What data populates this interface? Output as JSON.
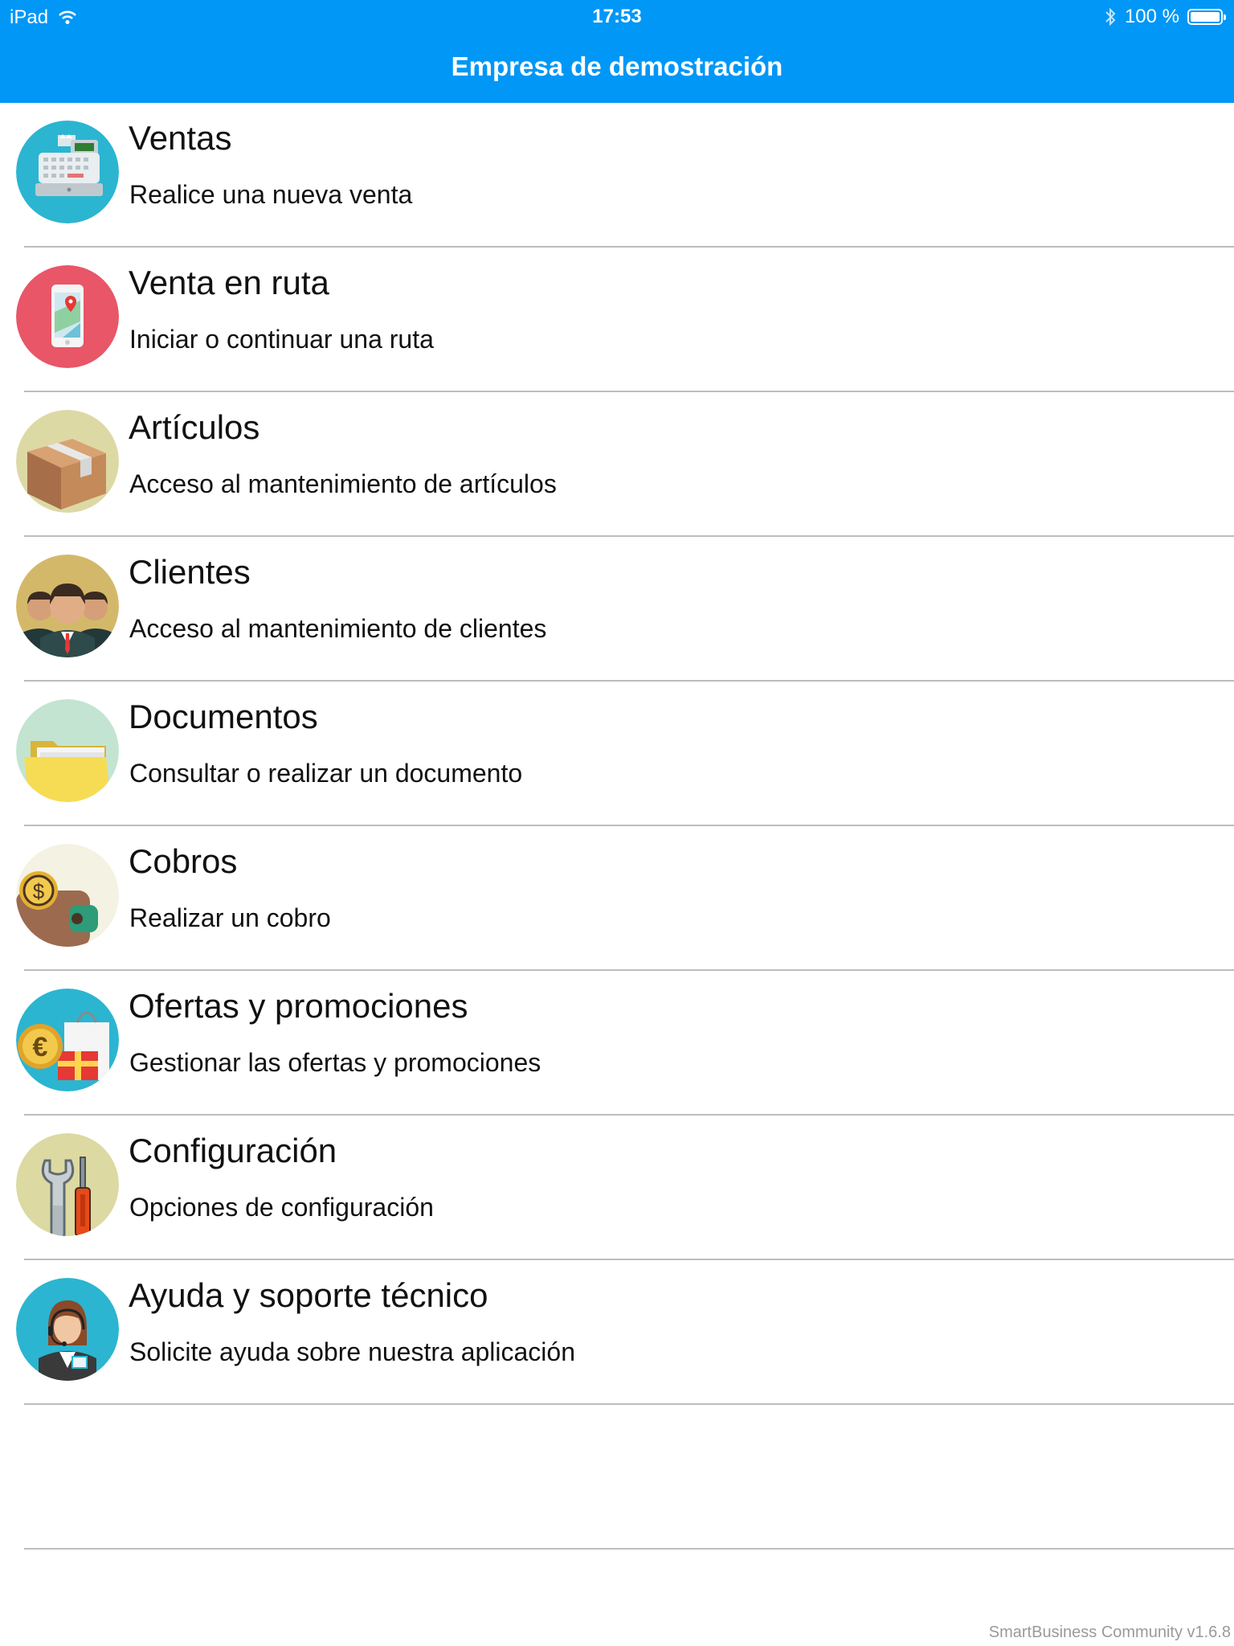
{
  "status_bar": {
    "device": "iPad",
    "time": "17:53",
    "battery": "100 %"
  },
  "header": {
    "title": "Empresa de demostración"
  },
  "menu": [
    {
      "title": "Ventas",
      "subtitle": "Realice una nueva venta",
      "icon": "cash-register-icon"
    },
    {
      "title": "Venta en ruta",
      "subtitle": "Iniciar o continuar una ruta",
      "icon": "phone-map-icon"
    },
    {
      "title": "Artículos",
      "subtitle": "Acceso al mantenimiento de artículos",
      "icon": "box-icon"
    },
    {
      "title": "Clientes",
      "subtitle": "Acceso al mantenimiento de clientes",
      "icon": "people-icon"
    },
    {
      "title": "Documentos",
      "subtitle": "Consultar o realizar un documento",
      "icon": "folder-icon"
    },
    {
      "title": "Cobros",
      "subtitle": "Realizar un cobro",
      "icon": "wallet-coin-icon"
    },
    {
      "title": "Ofertas y promociones",
      "subtitle": "Gestionar las ofertas y promociones",
      "icon": "euro-gift-icon"
    },
    {
      "title": "Configuración",
      "subtitle": "Opciones de configuración",
      "icon": "tools-icon"
    },
    {
      "title": "Ayuda y soporte técnico",
      "subtitle": "Solicite ayuda sobre nuestra aplicación",
      "icon": "support-agent-icon"
    }
  ],
  "footer": {
    "version": "SmartBusiness Community v1.6.8"
  },
  "colors": {
    "header": "#0097f7",
    "divider": "#bdbdbd",
    "footer_text": "#9a9a9a"
  }
}
